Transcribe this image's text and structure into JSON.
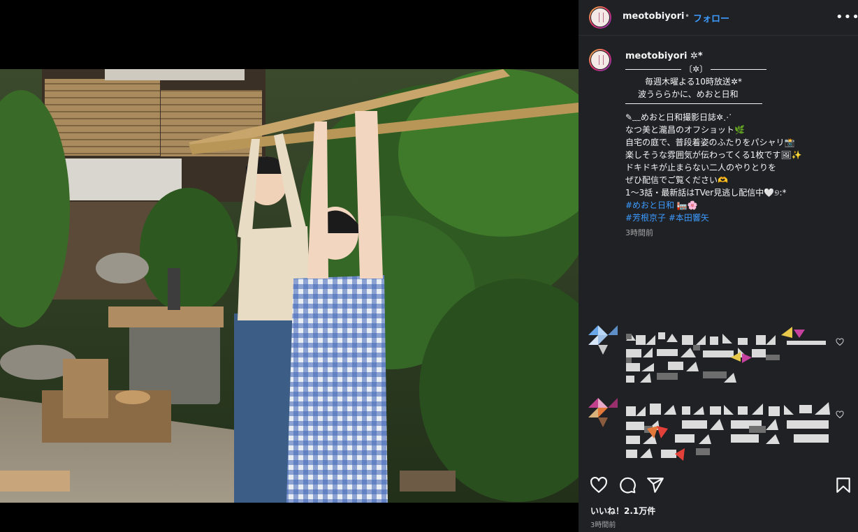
{
  "post": {
    "username": "meotobiyori",
    "follow_label": "フォロー",
    "more_label": "•••",
    "dot": "•"
  },
  "caption": {
    "username": "meotobiyori ✲*",
    "lines": [
      "〔✲〕",
      "毎週木曜よる10時放送✲*",
      "波うららかに、めおと日和",
      "",
      "✎﹏めおと日和撮影日誌✲⋰",
      "",
      "なつ美と瀧昌のオフショット🌿",
      "",
      "自宅の庭で、普段着姿のふたりをパシャリ📸",
      "楽しそうな雰囲気が伝わってくる1枚です🖼✨",
      "",
      "ドキドキが止まらない二人のやりとりを",
      "ぜひ配信でご覧ください🫶",
      "",
      "1〜3話・最新話はTVer見逃し配信中🤍୭:*",
      ""
    ],
    "hashtags_line1": "#めおと日和 🏣🌸",
    "hashtags_line2": "#芳根京子 #本田響矢",
    "time": "3時間前"
  },
  "footer": {
    "likes": "いいね！2.1万件",
    "time": "3時間前"
  },
  "icons": {
    "like": "heart-icon",
    "comment": "comment-icon",
    "share": "share-icon",
    "save": "bookmark-icon"
  },
  "colors": {
    "panel_bg": "#1f2125",
    "link": "#3d9bff",
    "muted": "#a8a8a8"
  }
}
